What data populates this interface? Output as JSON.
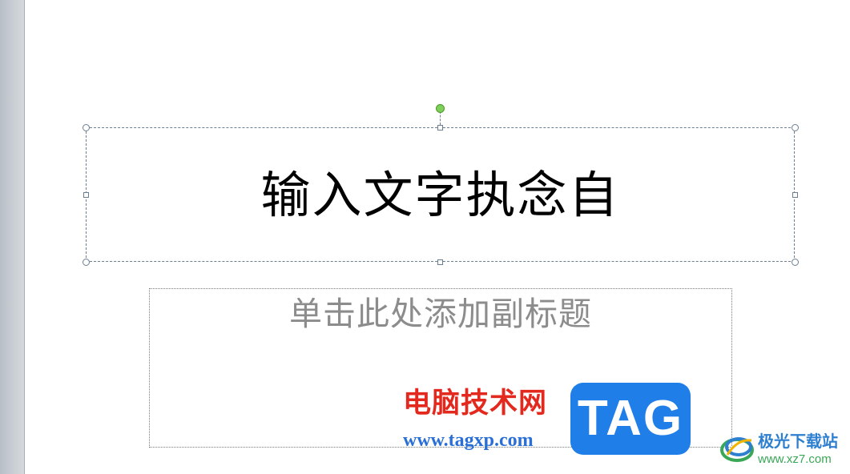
{
  "slide": {
    "title_placeholder": {
      "text": "输入文字执念自"
    },
    "subtitle_placeholder": {
      "text": "单击此处添加副标题"
    }
  },
  "watermarks": {
    "site_name": "电脑技术网",
    "site_url": "www.tagxp.com",
    "tag_badge": "TAG",
    "xz7_name": "极光下载站",
    "xz7_url": "www.xz7.com"
  },
  "colors": {
    "selection_outline": "#6b7f94",
    "rotate_handle": "#7ed05a",
    "title_text": "#000000",
    "subtitle_placeholder_text": "#8c8c8c",
    "watermark_red": "#e3281e",
    "watermark_blue": "#1f7ee8"
  }
}
